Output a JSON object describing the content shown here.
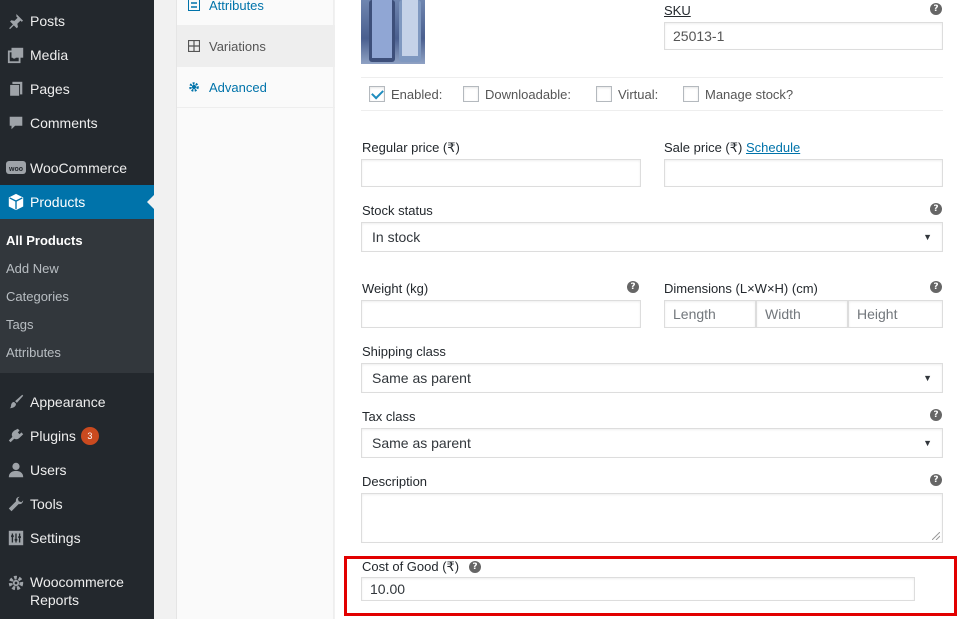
{
  "sidebar": {
    "items": [
      {
        "label": "Posts",
        "icon": "pin-icon"
      },
      {
        "label": "Media",
        "icon": "media-icon"
      },
      {
        "label": "Pages",
        "icon": "pages-icon"
      },
      {
        "label": "Comments",
        "icon": "comment-icon"
      },
      {
        "label": "WooCommerce",
        "icon": "woo-icon"
      },
      {
        "label": "Products",
        "icon": "product-box-icon"
      },
      {
        "label": "Appearance",
        "icon": "brush-icon"
      },
      {
        "label": "Plugins",
        "icon": "plug-icon",
        "badge": "3"
      },
      {
        "label": "Users",
        "icon": "user-icon"
      },
      {
        "label": "Tools",
        "icon": "wrench-icon"
      },
      {
        "label": "Settings",
        "icon": "settings-icon"
      },
      {
        "label": "Woocommerce\nReports",
        "line1": "Woocommerce",
        "line2": "Reports",
        "icon": "gear-icon"
      }
    ],
    "submenu": [
      "All Products",
      "Add New",
      "Categories",
      "Tags",
      "Attributes"
    ],
    "current": "Products",
    "current_sub": "All Products"
  },
  "tabs": {
    "items": [
      {
        "label": "Attributes",
        "icon": "list-icon"
      },
      {
        "label": "Variations",
        "icon": "grid-icon"
      },
      {
        "label": "Advanced",
        "icon": "gear-icon"
      }
    ],
    "active": "Variations"
  },
  "variation": {
    "sku_label": "SKU",
    "sku_value": "25013-1",
    "checkboxes": [
      {
        "label": "Enabled:",
        "checked": true
      },
      {
        "label": "Downloadable:",
        "checked": false
      },
      {
        "label": "Virtual:",
        "checked": false
      },
      {
        "label": "Manage stock?",
        "checked": false
      }
    ],
    "regular_price_label": "Regular price (₹)",
    "sale_price_label": "Sale price (₹)",
    "schedule_link": "Schedule",
    "stock_status_label": "Stock status",
    "stock_status_value": "In stock",
    "weight_label": "Weight (kg)",
    "dimensions_label": "Dimensions (L×W×H) (cm)",
    "length_ph": "Length",
    "width_ph": "Width",
    "height_ph": "Height",
    "shipping_class_label": "Shipping class",
    "shipping_class_value": "Same as parent",
    "tax_class_label": "Tax class",
    "tax_class_value": "Same as parent",
    "description_label": "Description",
    "cost_label": "Cost of Good (₹)",
    "cost_value": "10.00",
    "help_glyph": "?"
  },
  "colors": {
    "sidebar_bg": "#23282d",
    "accent": "#0073aa",
    "highlight": "#e20000",
    "badge": "#ca4a1f"
  }
}
